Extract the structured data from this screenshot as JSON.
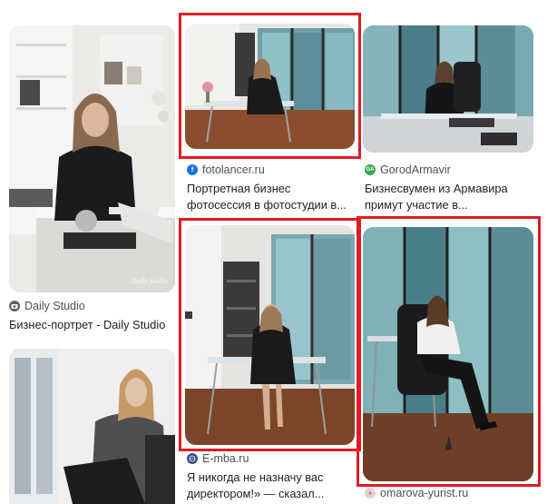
{
  "results": [
    {
      "source": "Daily Studio",
      "title_line1": "Бизнес-портрет - Daily Studio",
      "title_line2": "",
      "watermark": "Daily Studio",
      "favicon_icon": "camera-icon",
      "favicon_color": "#5f6368"
    },
    {
      "source": "fotolancer.ru",
      "title_line1": "Портретная бизнес",
      "title_line2": "фотосессия в фотостудии в...",
      "favicon_icon": "f-letter-icon",
      "favicon_color": "#1a73e8"
    },
    {
      "source": "GorodArmavir",
      "title_line1": "Бизнесвумен из Армавира",
      "title_line2": "примут участие в...",
      "favicon_icon": "ga-badge-icon",
      "favicon_color": "#34a853"
    },
    {
      "source": "E-mba.ru",
      "title_line1": "Я никогда не назначу вас",
      "title_line2": "директором!» — сказал...",
      "favicon_icon": "globe-icon",
      "favicon_color": "#3c4a8c"
    },
    {
      "source": "omarova-yurist.ru",
      "title_line1": "",
      "title_line2": "",
      "favicon_icon": "flower-icon",
      "favicon_color": "#d9b3b3"
    },
    {
      "source": "",
      "title_line1": "",
      "title_line2": ""
    }
  ],
  "highlight_color": "#e01b24"
}
